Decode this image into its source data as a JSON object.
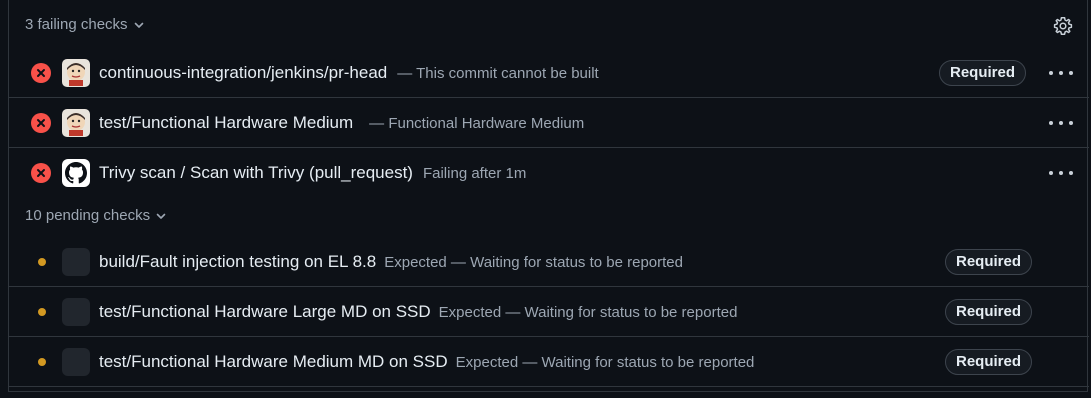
{
  "failing_section": {
    "header": "3 failing checks",
    "checks": [
      {
        "name": "continuous-integration/jenkins/pr-head",
        "description": "— This commit cannot be built",
        "required": "Required",
        "avatar": "jenkins-avatar"
      },
      {
        "name": "test/Functional Hardware Medium",
        "description": "— Functional Hardware Medium",
        "required": "",
        "avatar": "jenkins-avatar"
      },
      {
        "name": "Trivy scan / Scan with Trivy (pull_request)",
        "description": "Failing after 1m",
        "required": "",
        "avatar": "github-avatar"
      }
    ]
  },
  "pending_section": {
    "header": "10 pending checks",
    "checks": [
      {
        "name": "build/Fault injection testing on EL 8.8",
        "description": "Expected — Waiting for status to be reported",
        "required": "Required"
      },
      {
        "name": "test/Functional Hardware Large MD on SSD",
        "description": "Expected — Waiting for status to be reported",
        "required": "Required"
      },
      {
        "name": "test/Functional Hardware Medium MD on SSD",
        "description": "Expected — Waiting for status to be reported",
        "required": "Required"
      }
    ]
  },
  "colors": {
    "background": "#0d1117",
    "fail": "#f85149",
    "pending": "#d29922",
    "muted_text": "#9da7b3",
    "border": "#30363d"
  },
  "icons": {
    "settings": "gear-icon",
    "expand": "chevron-down-icon",
    "more": "kebab-horizontal-icon",
    "fail_status": "x-circle-fill-icon",
    "pending_status": "dot-fill-icon"
  }
}
